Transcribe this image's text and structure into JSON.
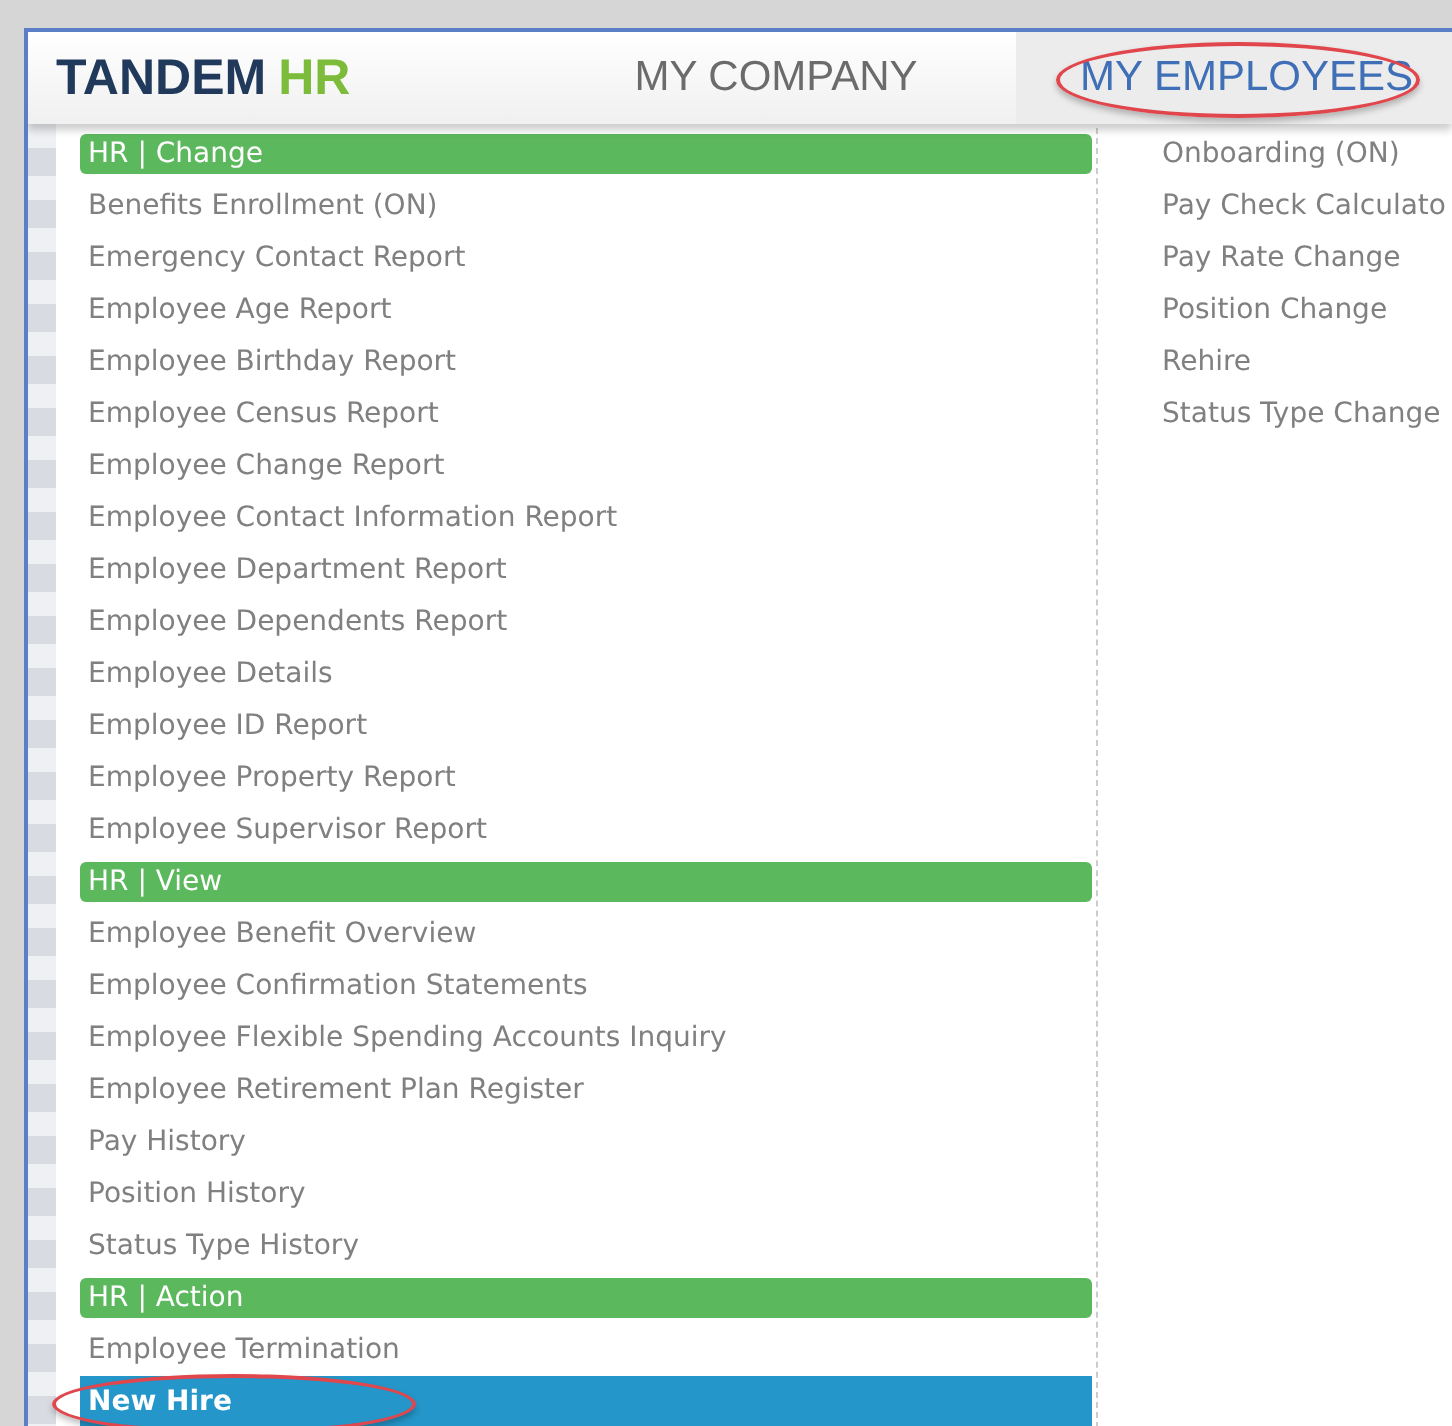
{
  "logo": {
    "brand": "TANDEM",
    "suffix": "HR"
  },
  "nav": [
    {
      "label": "MY COMPANY",
      "selected": false,
      "circled": false
    },
    {
      "label": "MY EMPLOYEES",
      "selected": true,
      "circled": true
    }
  ],
  "menu_left": [
    {
      "kind": "header",
      "label": "HR | Change"
    },
    {
      "kind": "item",
      "label": "Benefits Enrollment (ON)",
      "selected": false,
      "circled": false
    },
    {
      "kind": "item",
      "label": "Emergency Contact Report",
      "selected": false,
      "circled": false
    },
    {
      "kind": "item",
      "label": "Employee Age Report",
      "selected": false,
      "circled": false
    },
    {
      "kind": "item",
      "label": "Employee Birthday Report",
      "selected": false,
      "circled": false
    },
    {
      "kind": "item",
      "label": "Employee Census Report",
      "selected": false,
      "circled": false
    },
    {
      "kind": "item",
      "label": "Employee Change Report",
      "selected": false,
      "circled": false
    },
    {
      "kind": "item",
      "label": "Employee Contact Information Report",
      "selected": false,
      "circled": false
    },
    {
      "kind": "item",
      "label": "Employee Department Report",
      "selected": false,
      "circled": false
    },
    {
      "kind": "item",
      "label": "Employee Dependents Report",
      "selected": false,
      "circled": false
    },
    {
      "kind": "item",
      "label": "Employee Details",
      "selected": false,
      "circled": false
    },
    {
      "kind": "item",
      "label": "Employee ID Report",
      "selected": false,
      "circled": false
    },
    {
      "kind": "item",
      "label": "Employee Property Report",
      "selected": false,
      "circled": false
    },
    {
      "kind": "item",
      "label": "Employee Supervisor Report",
      "selected": false,
      "circled": false
    },
    {
      "kind": "header",
      "label": "HR | View"
    },
    {
      "kind": "item",
      "label": "Employee Benefit Overview",
      "selected": false,
      "circled": false
    },
    {
      "kind": "item",
      "label": "Employee Confirmation Statements",
      "selected": false,
      "circled": false
    },
    {
      "kind": "item",
      "label": "Employee Flexible Spending Accounts Inquiry",
      "selected": false,
      "circled": false
    },
    {
      "kind": "item",
      "label": "Employee Retirement Plan Register",
      "selected": false,
      "circled": false
    },
    {
      "kind": "item",
      "label": "Pay History",
      "selected": false,
      "circled": false
    },
    {
      "kind": "item",
      "label": "Position History",
      "selected": false,
      "circled": false
    },
    {
      "kind": "item",
      "label": "Status Type History",
      "selected": false,
      "circled": false
    },
    {
      "kind": "header",
      "label": "HR | Action"
    },
    {
      "kind": "item",
      "label": "Employee Termination",
      "selected": false,
      "circled": false
    },
    {
      "kind": "item",
      "label": "New Hire",
      "selected": true,
      "circled": true
    }
  ],
  "menu_right": [
    {
      "label": "Onboarding (ON)",
      "selected": false
    },
    {
      "label": "Pay Check Calculato",
      "selected": false
    },
    {
      "label": "Pay Rate Change",
      "selected": false
    },
    {
      "label": "Position Change",
      "selected": false
    },
    {
      "label": "Rehire",
      "selected": false
    },
    {
      "label": "Status Type Change",
      "selected": false
    }
  ]
}
